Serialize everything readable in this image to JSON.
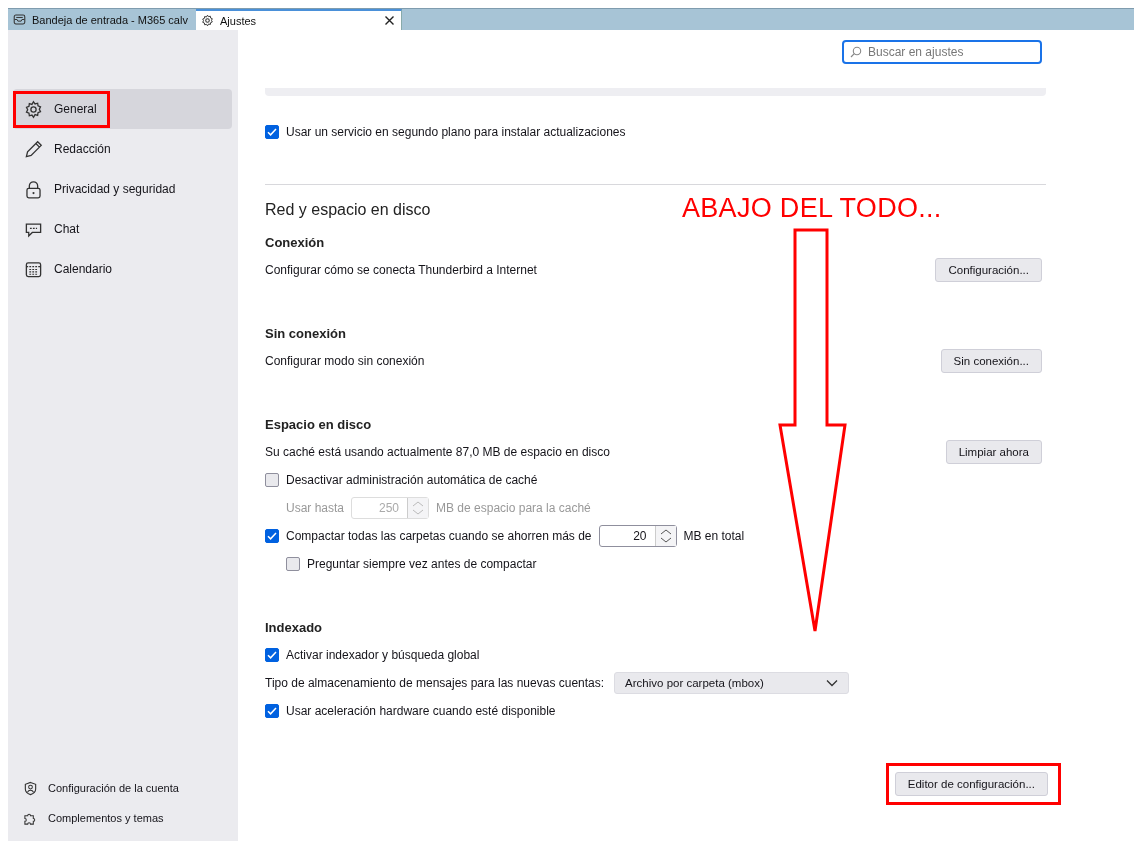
{
  "tabs": [
    {
      "label": "Bandeja de entrada - M365 calv",
      "kind": "mail",
      "selected": false,
      "closable": false
    },
    {
      "label": "Ajustes",
      "kind": "settings",
      "selected": true,
      "closable": true
    }
  ],
  "sidebar": {
    "items": [
      {
        "label": "General",
        "kind": "gear",
        "selected": true,
        "highlighted": true
      },
      {
        "label": "Redacción",
        "kind": "pencil",
        "selected": false,
        "highlighted": false
      },
      {
        "label": "Privacidad y seguridad",
        "kind": "lock",
        "selected": false,
        "highlighted": false
      },
      {
        "label": "Chat",
        "kind": "chat",
        "selected": false,
        "highlighted": false
      },
      {
        "label": "Calendario",
        "kind": "calendar",
        "selected": false,
        "highlighted": false
      }
    ],
    "footer_items": [
      {
        "label": "Configuración de la cuenta",
        "kind": "account"
      },
      {
        "label": "Complementos y temas",
        "kind": "puzzle"
      }
    ]
  },
  "search": {
    "placeholder": "Buscar en ajustes"
  },
  "top_option": {
    "label": "Usar un servicio en segundo plano para instalar actualizaciones",
    "checked": true
  },
  "section": {
    "title": "Red y espacio en disco",
    "groups": [
      {
        "heading": "Conexión",
        "description": "Configurar cómo se conecta Thunderbird a Internet",
        "button": "Configuración..."
      },
      {
        "heading": "Sin conexión",
        "description": "Configurar modo sin conexión",
        "button": "Sin conexión..."
      },
      {
        "heading": "Espacio en disco",
        "description": "Su caché está usando actualmente 87,0 MB de espacio en disco",
        "button": "Limpiar ahora",
        "rows": [
          {
            "kind": "checkbox",
            "label": "Desactivar administración automática de caché",
            "checked": false,
            "indented": false
          },
          {
            "kind": "spin",
            "label": "Usar hasta",
            "value": "250",
            "unit": "MB de espacio para la caché",
            "disabled": true,
            "indented": true
          },
          {
            "kind": "checkbox-spin",
            "label": "Compactar todas las carpetas cuando se ahorren más de",
            "checked": true,
            "value": "20",
            "unit": "MB en total",
            "indented": false
          },
          {
            "kind": "checkbox",
            "label": "Preguntar siempre vez antes de compactar",
            "checked": false,
            "indented": true
          }
        ]
      },
      {
        "heading": "Indexado",
        "rows": [
          {
            "kind": "checkbox",
            "label": "Activar indexador y búsqueda global",
            "checked": true,
            "indented": false
          },
          {
            "kind": "select",
            "label": "Tipo de almacenamiento de mensajes para las nuevas cuentas:",
            "value": "Archivo por carpeta (mbox)"
          },
          {
            "kind": "checkbox",
            "label": "Usar aceleración hardware cuando esté disponible",
            "checked": true,
            "indented": false
          }
        ]
      }
    ]
  },
  "footer_button": {
    "label": "Editor de configuración...",
    "highlighted": true
  },
  "annotation": {
    "text": "ABAJO DEL TODO..."
  }
}
